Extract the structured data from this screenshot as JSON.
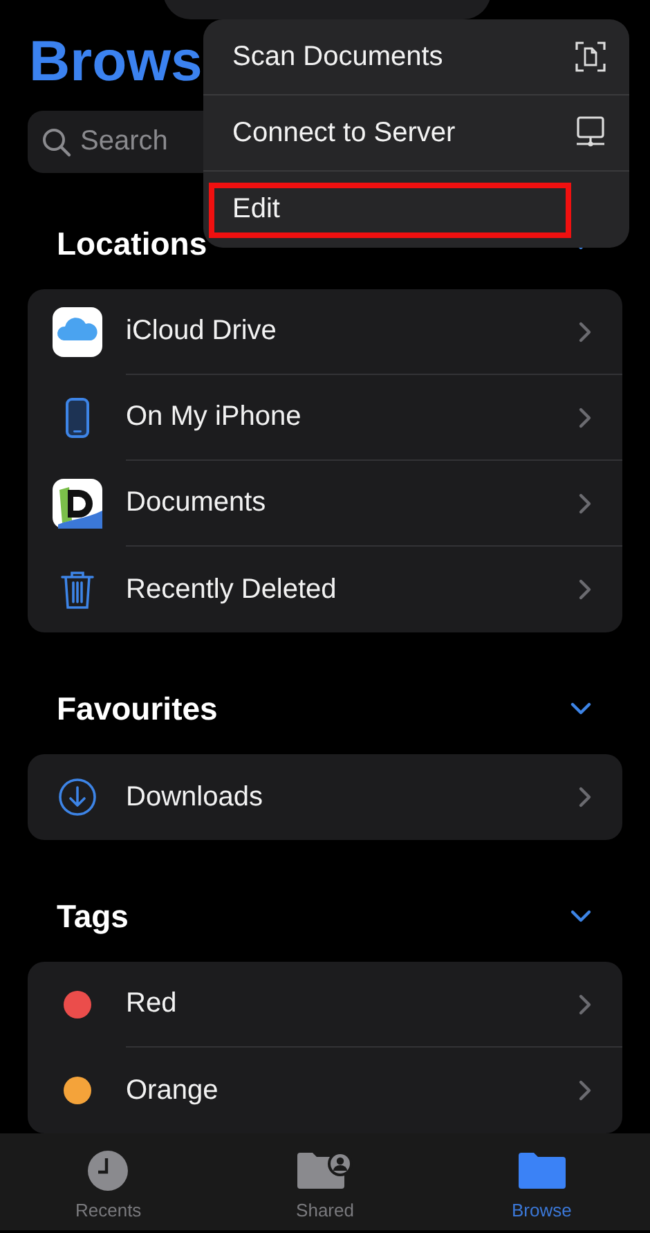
{
  "title": "Brows",
  "search": {
    "placeholder": "Search"
  },
  "sections": [
    {
      "heading": "Locations",
      "expanded": true,
      "items": [
        {
          "label": "iCloud Drive",
          "kind": "icloud"
        },
        {
          "label": "On My iPhone",
          "kind": "phone"
        },
        {
          "label": "Documents",
          "kind": "app"
        },
        {
          "label": "Recently Deleted",
          "kind": "trash"
        }
      ]
    },
    {
      "heading": "Favourites",
      "expanded": true,
      "items": [
        {
          "label": "Downloads",
          "kind": "downloads"
        }
      ]
    },
    {
      "heading": "Tags",
      "expanded": true,
      "items": [
        {
          "label": "Red",
          "kind": "tag",
          "color": "#eb4d4b"
        },
        {
          "label": "Orange",
          "kind": "tag",
          "color": "#f4a33a"
        }
      ]
    }
  ],
  "menu": {
    "items": [
      {
        "label": "Scan Documents",
        "kind": "scan",
        "highlighted": false
      },
      {
        "label": "Connect to Server",
        "kind": "server",
        "highlighted": false
      },
      {
        "label": "Edit",
        "kind": "plain",
        "highlighted": true
      }
    ]
  },
  "tab_bar": [
    {
      "label": "Recents",
      "kind": "clock",
      "selected": false
    },
    {
      "label": "Shared",
      "kind": "shared",
      "selected": false
    },
    {
      "label": "Browse",
      "kind": "folder",
      "selected": true
    }
  ]
}
